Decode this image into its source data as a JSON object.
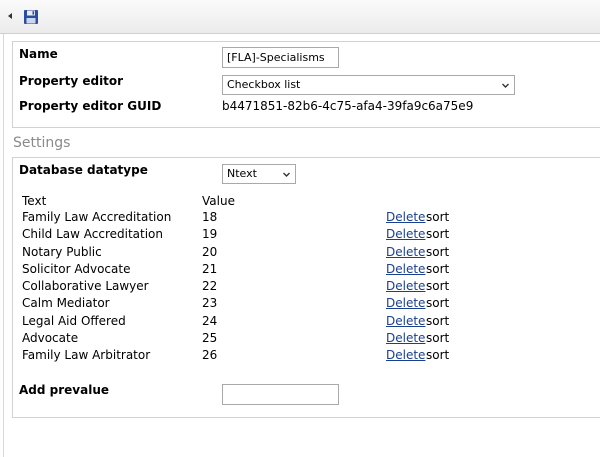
{
  "toolbar": {
    "back_icon": "caret-left-icon",
    "save_icon": "floppy-disk-icon"
  },
  "general": {
    "name_label": "Name",
    "name_value": "[FLA]-Specialisms",
    "property_editor_label": "Property editor",
    "property_editor_value": "Checkbox list",
    "guid_label": "Property editor GUID",
    "guid_value": "b4471851-82b6-4c75-afa4-39fa9c6a75e9"
  },
  "settings": {
    "heading": "Settings",
    "db_datatype_label": "Database datatype",
    "db_datatype_value": "Ntext",
    "table": {
      "col_text": "Text",
      "col_value": "Value",
      "delete_label": "Delete",
      "sort_label": "sort",
      "rows": [
        {
          "text": "Family Law Accreditation",
          "value": "18"
        },
        {
          "text": "Child Law Accreditation",
          "value": "19"
        },
        {
          "text": "Notary Public",
          "value": "20"
        },
        {
          "text": "Solicitor Advocate",
          "value": "21"
        },
        {
          "text": "Collaborative Lawyer",
          "value": "22"
        },
        {
          "text": "Calm Mediator",
          "value": "23"
        },
        {
          "text": "Legal Aid Offered",
          "value": "24"
        },
        {
          "text": "Advocate",
          "value": "25"
        },
        {
          "text": "Family Law Arbitrator",
          "value": "26"
        }
      ]
    },
    "add_prevalue_label": "Add prevalue",
    "add_prevalue_value": ""
  }
}
